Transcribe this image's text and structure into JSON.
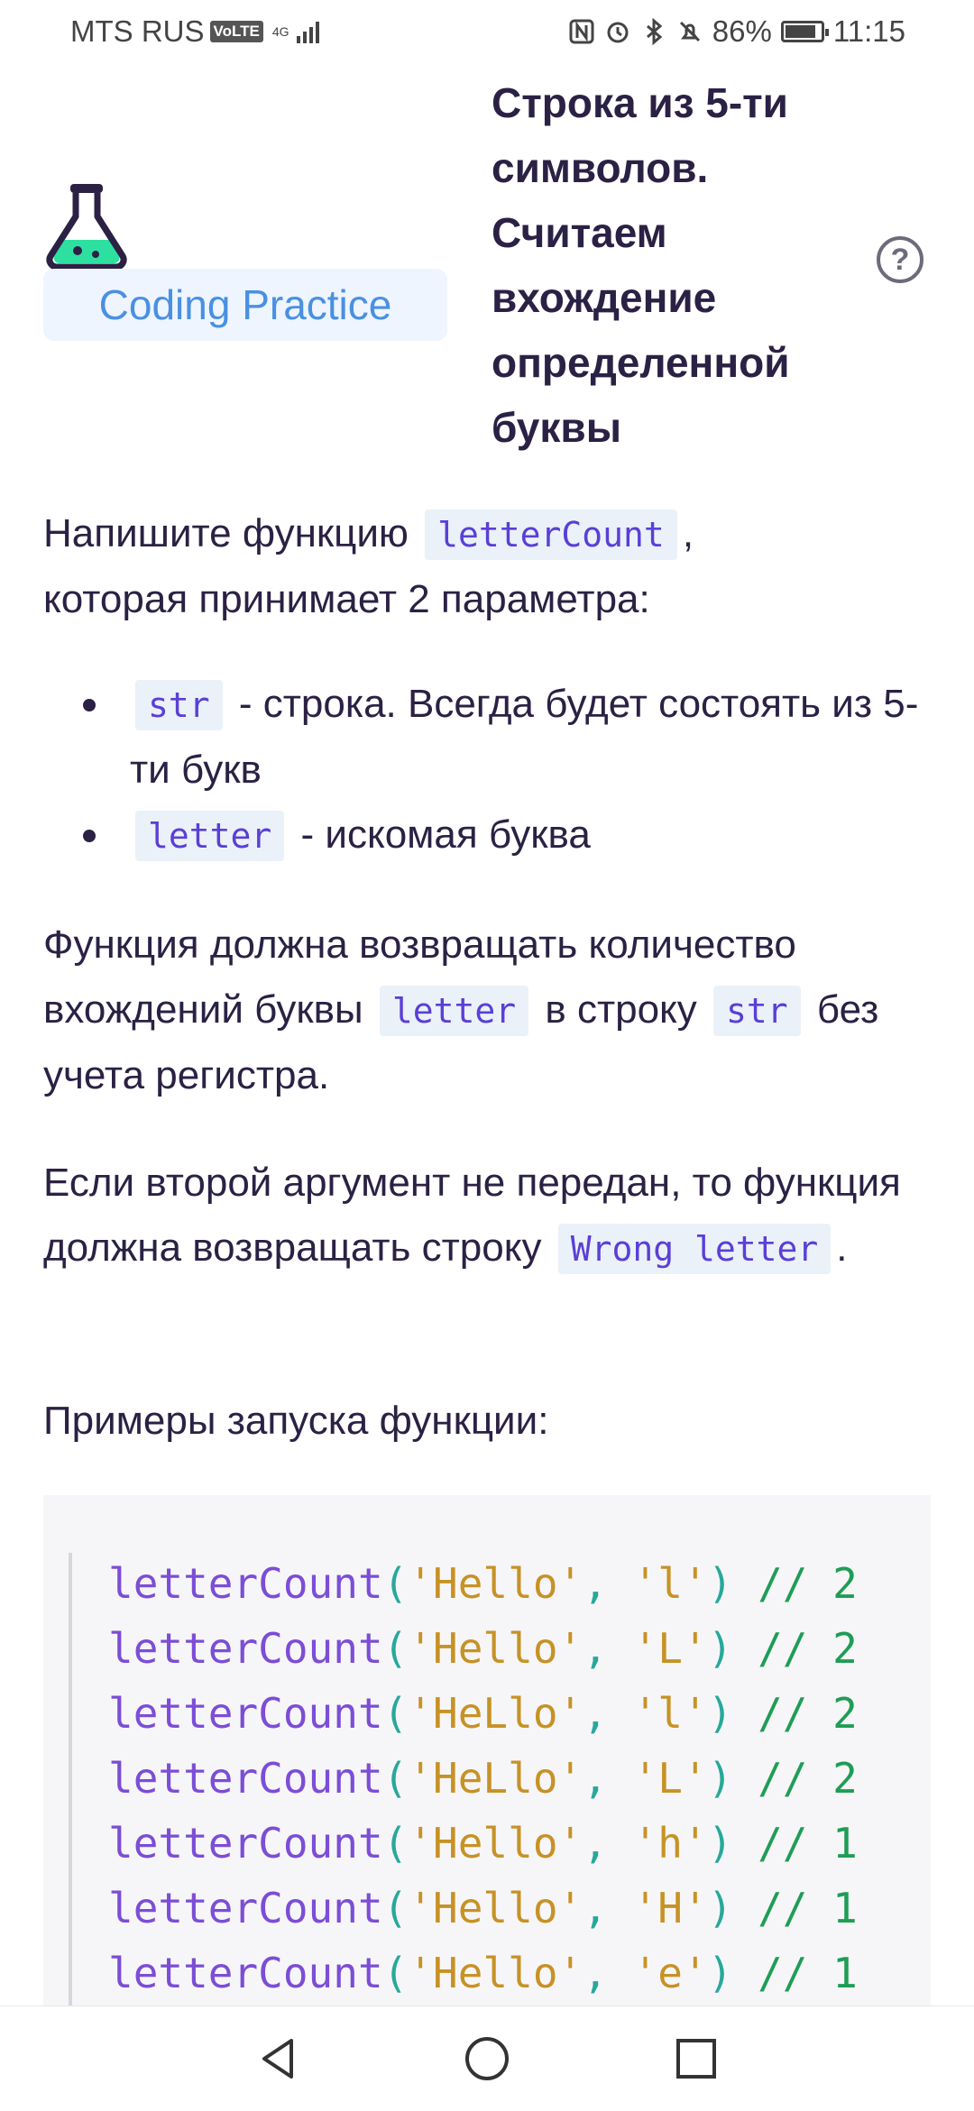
{
  "status_bar": {
    "carrier": "MTS RUS",
    "volte": "VoLTE",
    "network": "4G",
    "battery": "86%",
    "time": "11:15"
  },
  "header": {
    "badge": "Coding Practice",
    "title": "Строка из 5-ти символов. Считаем вхождение определенной буквы",
    "help_icon": "?"
  },
  "content": {
    "intro_prefix": "Напишите функцию",
    "intro_code": "letterCount",
    "intro_suffix": ",",
    "intro_line2": "которая принимает 2 параметра:",
    "params": [
      {
        "code": "str",
        "text": "- строка. Всегда будет состоять из 5-ти букв"
      },
      {
        "code": "letter",
        "text": "- искомая буква"
      }
    ],
    "return_p1": "Функция должна возвращать количество вхождений буквы",
    "return_code1": "letter",
    "return_p2": "в строку",
    "return_code2": "str",
    "return_p3": "без учета регистра.",
    "missing_p1": "Если второй аргумент не передан, то функция должна возвращать строку",
    "missing_code": "Wrong letter",
    "missing_p2": ".",
    "examples_label": "Примеры запуска функции:"
  },
  "code_examples": [
    {
      "fn": "letterCount",
      "str": "'Hello'",
      "letter": "'l'",
      "result": "// 2"
    },
    {
      "fn": "letterCount",
      "str": "'Hello'",
      "letter": "'L'",
      "result": "// 2"
    },
    {
      "fn": "letterCount",
      "str": "'HeLlo'",
      "letter": "'l'",
      "result": "// 2"
    },
    {
      "fn": "letterCount",
      "str": "'HeLlo'",
      "letter": "'L'",
      "result": "// 2"
    },
    {
      "fn": "letterCount",
      "str": "'Hello'",
      "letter": "'h'",
      "result": "// 1"
    },
    {
      "fn": "letterCount",
      "str": "'Hello'",
      "letter": "'H'",
      "result": "// 1"
    },
    {
      "fn": "letterCount",
      "str": "'Hello'",
      "letter": "'e'",
      "result": "// 1"
    }
  ],
  "colors": {
    "accent": "#4a90e2",
    "badge_bg": "#eef5fe",
    "flask_liquid": "#2ee0a0",
    "text": "#2b2144"
  },
  "nav": {
    "icons": [
      "back-icon",
      "home-icon",
      "recents-icon"
    ]
  }
}
